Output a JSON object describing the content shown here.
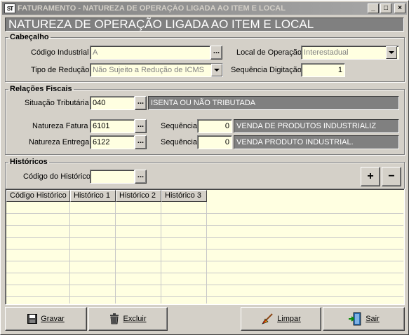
{
  "window": {
    "app_icon_text": "ST",
    "title": "FATURAMENTO - NATUREZA DE OPERAÇÃO LIGADA AO ITEM E LOCAL",
    "minimize": "_",
    "maximize": "□",
    "close": "×"
  },
  "banner": "NATUREZA DE OPERAÇÃO LIGADA AO ITEM E LOCAL",
  "cabecalho": {
    "legend": "Cabeçalho",
    "codigo_industrial_label": "Código Industrial",
    "codigo_industrial_value": "A",
    "local_operacao_label": "Local de Operação",
    "local_operacao_value": "Interestadual",
    "tipo_reducao_label": "Tipo de Redução",
    "tipo_reducao_value": "Não Sujeito a Redução de ICMS",
    "sequencia_digitacao_label": "Sequência Digitação",
    "sequencia_digitacao_value": "1"
  },
  "relacoes": {
    "legend": "Relações Fiscais",
    "situacao_label": "Situação Tributária",
    "situacao_code": "040",
    "situacao_desc": "ISENTA OU NÃO TRIBUTADA",
    "fatura_label": "Natureza Fatura",
    "fatura_code": "6101",
    "fatura_seq_label": "Sequência",
    "fatura_seq": "0",
    "fatura_desc": "VENDA DE PRODUTOS INDUSTRIALIZ",
    "entrega_label": "Natureza Entrega",
    "entrega_code": "6122",
    "entrega_seq_label": "Sequência",
    "entrega_seq": "0",
    "entrega_desc": "VENDA PRODUTO INDUSTRIAL."
  },
  "historicos": {
    "legend": "Históricos",
    "codigo_label": "Código do Histórico",
    "codigo_value": "",
    "add": "+",
    "remove": "−",
    "columns": [
      "Código Histórico",
      "Histórico 1",
      "Histórico 2",
      "Histórico 3"
    ]
  },
  "ellipsis": "...",
  "buttons": {
    "gravar": "Gravar",
    "excluir": "Excluir",
    "limpar": "Limpar",
    "sair": "Sair"
  }
}
